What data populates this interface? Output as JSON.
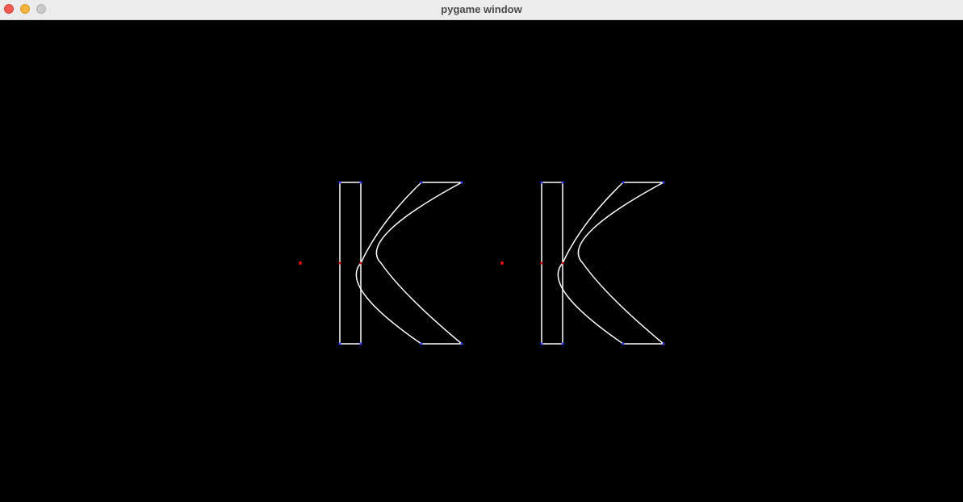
{
  "window": {
    "title": "pygame window"
  },
  "colors": {
    "background": "#000000",
    "outline": "#ffffff",
    "vertex": "#3a3aff",
    "anchor": "#e01010"
  },
  "icons": {
    "close": "close-icon",
    "minimize": "minimize-icon",
    "zoom": "zoom-icon"
  }
}
